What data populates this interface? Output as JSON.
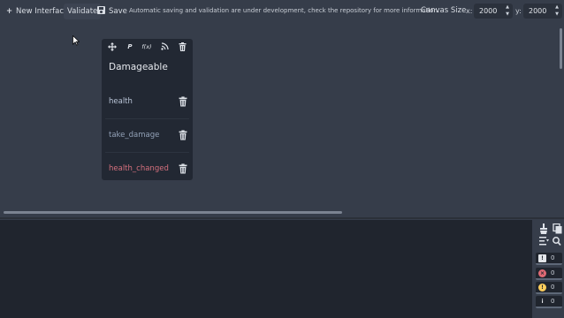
{
  "toolbar": {
    "new_interface_label": "New Interface",
    "validate_label": "Validate",
    "save_label": "Save",
    "notice": "Automatic saving and validation are under development, check the repository for more information.",
    "canvas_size_label": "Canvas Size",
    "x_label": "x:",
    "y_label": "y:",
    "canvas_x": "2000",
    "canvas_y": "2000"
  },
  "node": {
    "title": "Damageable",
    "tools": [
      "move-icon",
      "add-property-icon",
      "add-function-icon",
      "add-signal-icon",
      "delete-icon"
    ],
    "members": [
      {
        "name": "health",
        "kind": "property",
        "color": "#b9c4d6"
      },
      {
        "name": "take_damage",
        "kind": "function",
        "color": "#93a2b8"
      },
      {
        "name": "health_changed",
        "kind": "signal",
        "color": "#d5707d"
      }
    ]
  },
  "output_panel": {
    "tools": [
      "clear-icon",
      "copy-icon",
      "filter-icon",
      "search-icon"
    ],
    "counters": [
      {
        "type": "messages",
        "count": "0",
        "color": "#e3e6ea"
      },
      {
        "type": "errors",
        "count": "0",
        "color": "#e06a75"
      },
      {
        "type": "warnings",
        "count": "0",
        "color": "#ffce5c"
      },
      {
        "type": "info",
        "count": "0",
        "color": "#e3e6ea"
      }
    ]
  },
  "colors": {
    "editor_background": "#363d4a",
    "node_background": "#222833",
    "panel_background": "#20252e",
    "signal_color": "#d5707d"
  }
}
